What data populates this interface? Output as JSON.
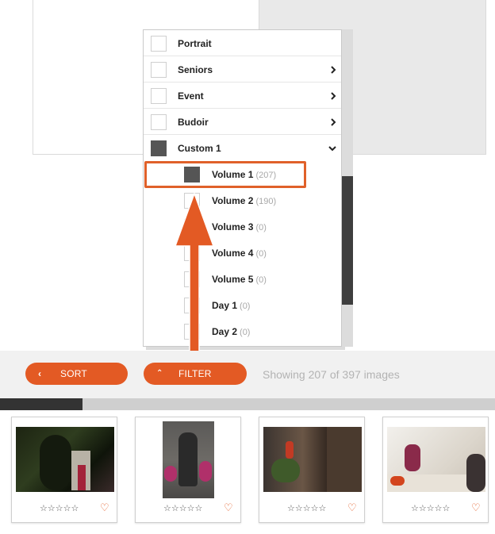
{
  "dropdown": {
    "items": [
      {
        "label": "Portrait",
        "checked": false,
        "has_submenu": false
      },
      {
        "label": "Seniors",
        "checked": false,
        "has_submenu": true
      },
      {
        "label": "Event",
        "checked": false,
        "has_submenu": true
      },
      {
        "label": "Budoir",
        "checked": false,
        "has_submenu": true
      },
      {
        "label": "Custom 1",
        "checked": true,
        "expanded": true
      }
    ],
    "subitems": [
      {
        "label": "Volume 1",
        "count": "(207)",
        "checked": true
      },
      {
        "label": "Volume 2",
        "count": "(190)",
        "checked": false
      },
      {
        "label": "Volume 3",
        "count": "(0)",
        "checked": false
      },
      {
        "label": "Volume 4",
        "count": "(0)",
        "checked": false
      },
      {
        "label": "Volume 5",
        "count": "(0)",
        "checked": false
      },
      {
        "label": "Day 1",
        "count": "(0)",
        "checked": false
      },
      {
        "label": "Day 2",
        "count": "(0)",
        "checked": false
      }
    ]
  },
  "toolbar": {
    "sort_label": "SORT",
    "sort_icon": "chevron-left-icon",
    "filter_label": "FILTER",
    "filter_icon": "chevron-up-icon",
    "showing_text": "Showing 207 of 397 images"
  },
  "progress": {
    "fraction": 0.167
  },
  "thumbnails": [
    {
      "rating_stars": "☆☆☆☆☆",
      "favorite_icon": "heart-icon"
    },
    {
      "rating_stars": "☆☆☆☆☆",
      "favorite_icon": "heart-icon"
    },
    {
      "rating_stars": "☆☆☆☆☆",
      "favorite_icon": "heart-icon"
    },
    {
      "rating_stars": "☆☆☆☆☆",
      "favorite_icon": "heart-icon"
    }
  ],
  "colors": {
    "accent": "#e35a24",
    "highlight": "#e0612a",
    "checked": "#555555",
    "scrollbar": "#3e3e3e"
  }
}
